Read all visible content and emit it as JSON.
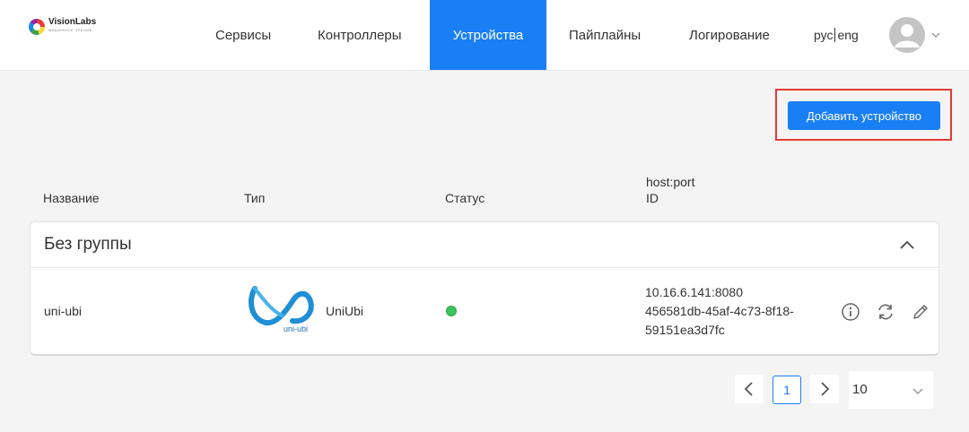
{
  "logo": {
    "name": "VisionLabs",
    "tagline": "МАШИННОЕ ЗРЕНИЕ"
  },
  "nav": {
    "items": [
      "Сервисы",
      "Контроллеры",
      "Устройства",
      "Пайплайны",
      "Логирование"
    ],
    "active": "Устройства"
  },
  "lang": {
    "ru": "рус",
    "en": "eng"
  },
  "toolbar": {
    "add_device_label": "Добавить устройство"
  },
  "table": {
    "columns": {
      "name": "Название",
      "type": "Тип",
      "status": "Статус",
      "host_port": "host:port",
      "id": "ID"
    },
    "groups": [
      {
        "title": "Без группы",
        "expanded": true,
        "rows": [
          {
            "name": "uni-ubi",
            "type": "UniUbi",
            "type_logo_text": "uni-ubi",
            "status": "online",
            "host_port": "10.16.6.141:8080",
            "id_line1": "456581db-45af-4c73-8f18-",
            "id_line2": "59151ea3d7fc"
          }
        ]
      }
    ]
  },
  "pagination": {
    "current_page": "1",
    "page_size": "10"
  },
  "colors": {
    "accent": "#1a7ff5",
    "status_online": "#3ec45a",
    "highlight": "#e53935"
  }
}
